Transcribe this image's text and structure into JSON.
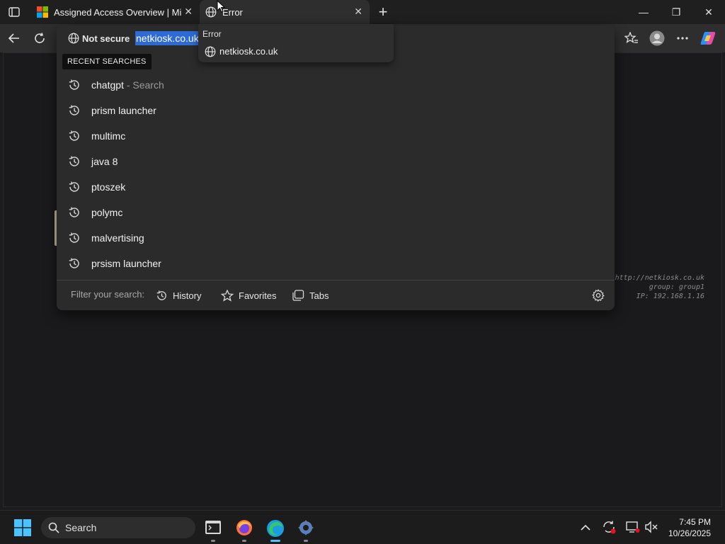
{
  "browser": {
    "tabs": [
      {
        "title": "Assigned Access Overview | Micro",
        "active": false,
        "icon": "microsoft-logo"
      },
      {
        "title": "Error",
        "active": true,
        "icon": "globe-icon"
      }
    ],
    "tab_close": "✕",
    "new_tab": "+",
    "window": {
      "minimize": "—",
      "restore": "❐",
      "close": "✕"
    }
  },
  "addressbar": {
    "security_label": "Not secure",
    "url": "netkiosk.co.uk"
  },
  "tab_flyout": {
    "title": "Error",
    "url": "netkiosk.co.uk"
  },
  "dropdown": {
    "recent_label": "RECENT SEARCHES",
    "items": [
      {
        "text": "chatgpt",
        "suffix": " - Search"
      },
      {
        "text": "prism launcher",
        "suffix": ""
      },
      {
        "text": "multimc",
        "suffix": ""
      },
      {
        "text": "java 8",
        "suffix": ""
      },
      {
        "text": "ptoszek",
        "suffix": ""
      },
      {
        "text": "polymc",
        "suffix": ""
      },
      {
        "text": "malvertising",
        "suffix": ""
      },
      {
        "text": "prsism launcher",
        "suffix": ""
      }
    ],
    "filter_label": "Filter your search:",
    "filters": [
      "History",
      "Favorites",
      "Tabs"
    ]
  },
  "page": {
    "kiosk_url": "http://netkiosk.co.uk",
    "group": "group: group1",
    "ip": "IP: 192.168.1.16"
  },
  "taskbar": {
    "search_label": "Search",
    "time": "7:45 PM",
    "date": "10/26/2025"
  },
  "colors": {
    "selection": "#2d6ad6",
    "accent": "#4cc2ff"
  }
}
